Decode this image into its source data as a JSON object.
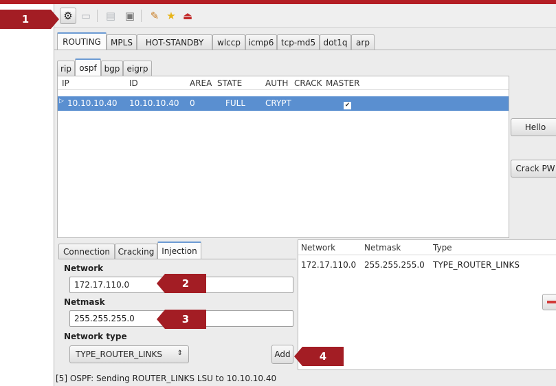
{
  "toolbar": {
    "icons": [
      "routing-plugin-icon",
      "folder-icon",
      "server-icon",
      "window-icon",
      "edit-icon",
      "star-icon",
      "exit-icon"
    ]
  },
  "callouts": {
    "c1": "1",
    "c2": "2",
    "c3": "3",
    "c4": "4"
  },
  "protocol_tabs": [
    "ROUTING",
    "MPLS",
    "HOT-STANDBY",
    "wlccp",
    "icmp6",
    "tcp-md5",
    "dot1q",
    "arp"
  ],
  "routing_tabs": [
    "rip",
    "ospf",
    "bgp",
    "eigrp"
  ],
  "neighbors": {
    "columns": [
      "IP",
      "ID",
      "AREA",
      "STATE",
      "AUTH",
      "CRACK",
      "MASTER"
    ],
    "rows": [
      {
        "ip": "10.10.10.40",
        "id": "10.10.10.40",
        "area": "0",
        "state": "FULL",
        "auth": "CRYPT",
        "crack": "",
        "master": "✔"
      }
    ]
  },
  "side_buttons": {
    "hello": "Hello",
    "crack": "Crack PW"
  },
  "config_tabs": [
    "Connection",
    "Cracking",
    "Injection"
  ],
  "injection": {
    "network_label": "Network",
    "network_value": "172.17.110.0",
    "netmask_label": "Netmask",
    "netmask_value": "255.255.255.0",
    "type_label": "Network type",
    "type_value": "TYPE_ROUTER_LINKS",
    "add_label": "Add"
  },
  "routes": {
    "columns": [
      "Network",
      "Netmask",
      "Type"
    ],
    "rows": [
      {
        "network": "172.17.110.0",
        "netmask": "255.255.255.0",
        "type": "TYPE_ROUTER_LINKS"
      }
    ]
  },
  "status": "[5] OSPF: Sending ROUTER_LINKS LSU to 10.10.10.40",
  "colors": {
    "accent_red": "#a31d24",
    "selection_blue": "#5a8fd0",
    "tab_highlight": "#6b9ad3"
  }
}
